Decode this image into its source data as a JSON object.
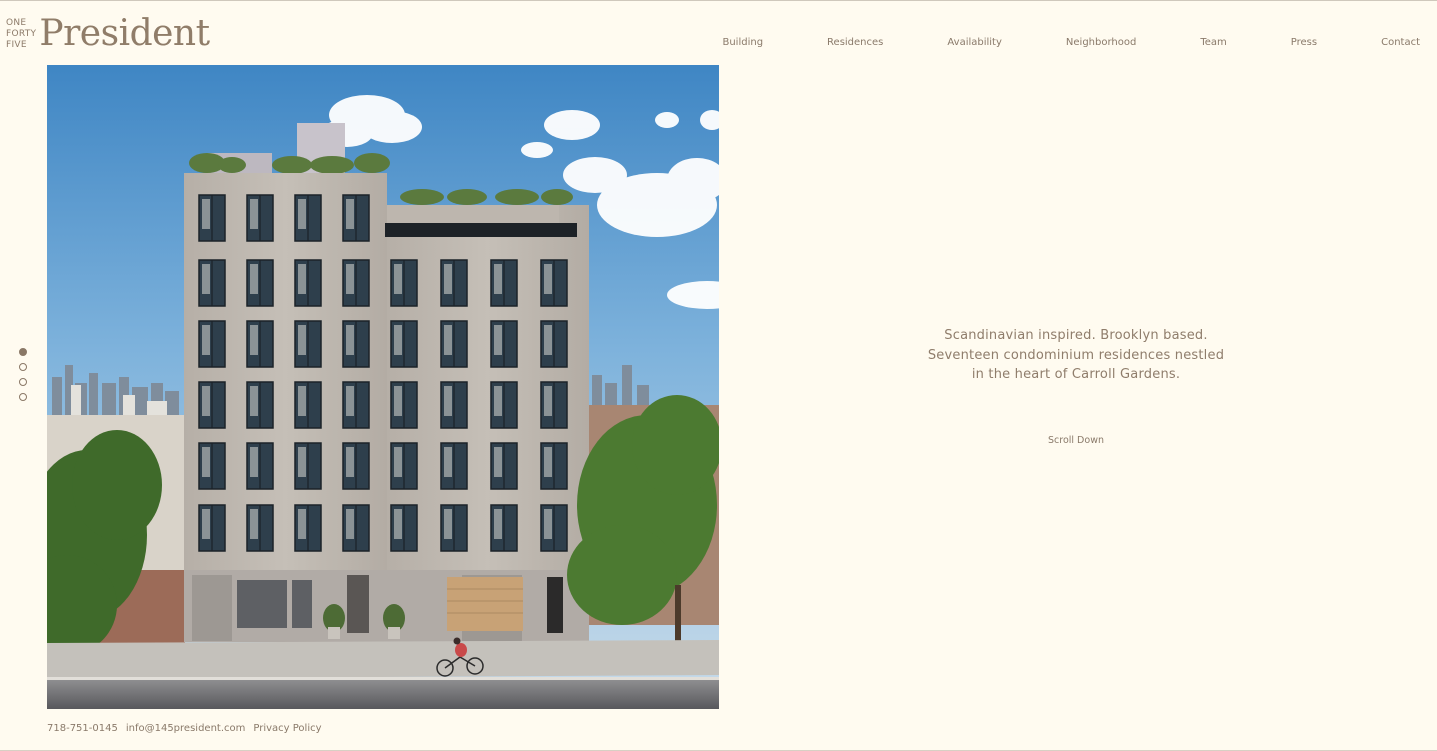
{
  "brand": {
    "small_lines": [
      "ONE",
      "FORTY",
      "FIVE"
    ],
    "name": "President"
  },
  "nav": {
    "items": [
      "Building",
      "Residences",
      "Availability",
      "Neighborhood",
      "Team",
      "Press",
      "Contact"
    ]
  },
  "hero": {
    "description": "Rendering of a seven-storey light brick apartment building with rooftop gardens, street trees, and a cyclist on the street"
  },
  "slider": {
    "count": 4,
    "active_index": 0
  },
  "tagline": {
    "lines": [
      "Scandinavian inspired. Brooklyn based.",
      "Seventeen condominium residences nestled",
      "in the heart of Carroll Gardens."
    ],
    "scroll_label": "Scroll Down"
  },
  "footer": {
    "phone": "718-751-0145",
    "email": "info@145president.com",
    "privacy": "Privacy Policy"
  },
  "colors": {
    "background": "#fffbf0",
    "brand": "#907d69",
    "text": "#8a7866"
  }
}
